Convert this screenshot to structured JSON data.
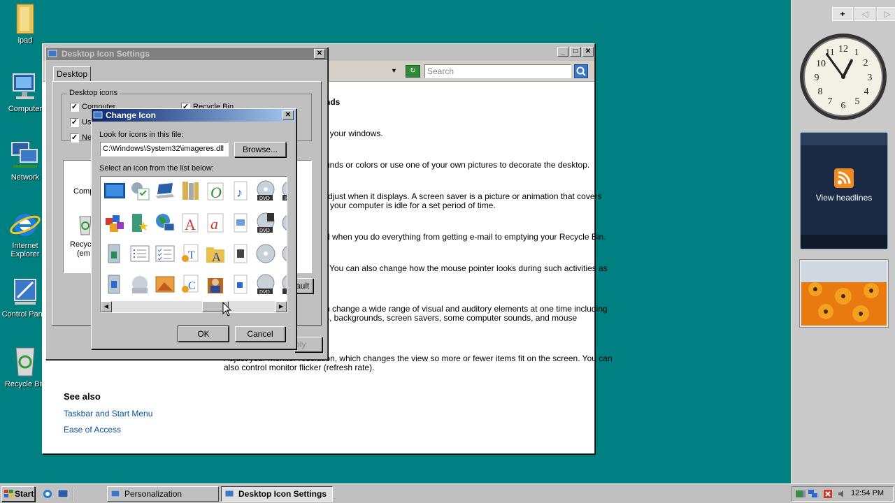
{
  "desktop": {
    "icons": [
      {
        "label": "ipad",
        "icon": "folder-icon"
      },
      {
        "label": "Computer",
        "icon": "computer-icon"
      },
      {
        "label": "Network",
        "icon": "network-icon"
      },
      {
        "label": "Internet Explorer",
        "icon": "ie-icon"
      },
      {
        "label": "Control Panel",
        "icon": "control-panel-icon"
      },
      {
        "label": "Recycle Bin",
        "icon": "recycle-bin-icon"
      }
    ]
  },
  "sidebar": {
    "add": "+",
    "prev": "◁",
    "next": "▷",
    "feed_label": "View headlines",
    "clock": {
      "hour_display": "12:54"
    }
  },
  "personalization": {
    "search_placeholder": "Search",
    "heading_fragment": "nds",
    "lines": [
      "f your windows.",
      "unds or colors or use one of your own pictures to decorate the desktop.",
      "djust when it displays. A screen saver is a picture or animation that covers",
      "your computer is idle for a set period of time.",
      "d when you do everything from getting e-mail to emptying your Recycle Bin.",
      "You can also change how the mouse pointer looks during such activities as",
      "n change a wide range of visual and auditory elements at one time including",
      "s, backgrounds, screen savers, some computer sounds, and mouse",
      "Adjust your monitor resolution, which changes the view so more or fewer items fit on the screen. You can",
      "also control monitor flicker (refresh rate)."
    ],
    "see_also": "See also",
    "links": [
      "Taskbar and Start Menu",
      "Ease of Access"
    ]
  },
  "desktop_icon_settings": {
    "title": "Desktop Icon Settings",
    "tab": "Desktop",
    "group_label": "Desktop icons",
    "checks": [
      {
        "label": "Computer",
        "checked": true
      },
      {
        "label": "Us",
        "checked": true
      },
      {
        "label": "Ne",
        "checked": true
      },
      {
        "label": "Recycle Bin",
        "checked": true
      }
    ],
    "preview_labels": [
      "Comp",
      "Recyc",
      "(em"
    ],
    "default_btn": "ault",
    "apply_btn": "ply"
  },
  "change_icon": {
    "title": "Change Icon",
    "look_label": "Look for icons in this file:",
    "file_path": "C:\\Windows\\System32\\imageres.dll",
    "browse": "Browse...",
    "select_label": "Select an icon from the list below:",
    "ok": "OK",
    "cancel": "Cancel"
  },
  "taskbar": {
    "start": "Start",
    "tasks": [
      "Personalization",
      "Desktop Icon Settings"
    ],
    "time": "12:54 PM"
  },
  "colors": {
    "desktop": "#008080",
    "title_active": "#0a246a",
    "title_inactive": "#808080"
  }
}
